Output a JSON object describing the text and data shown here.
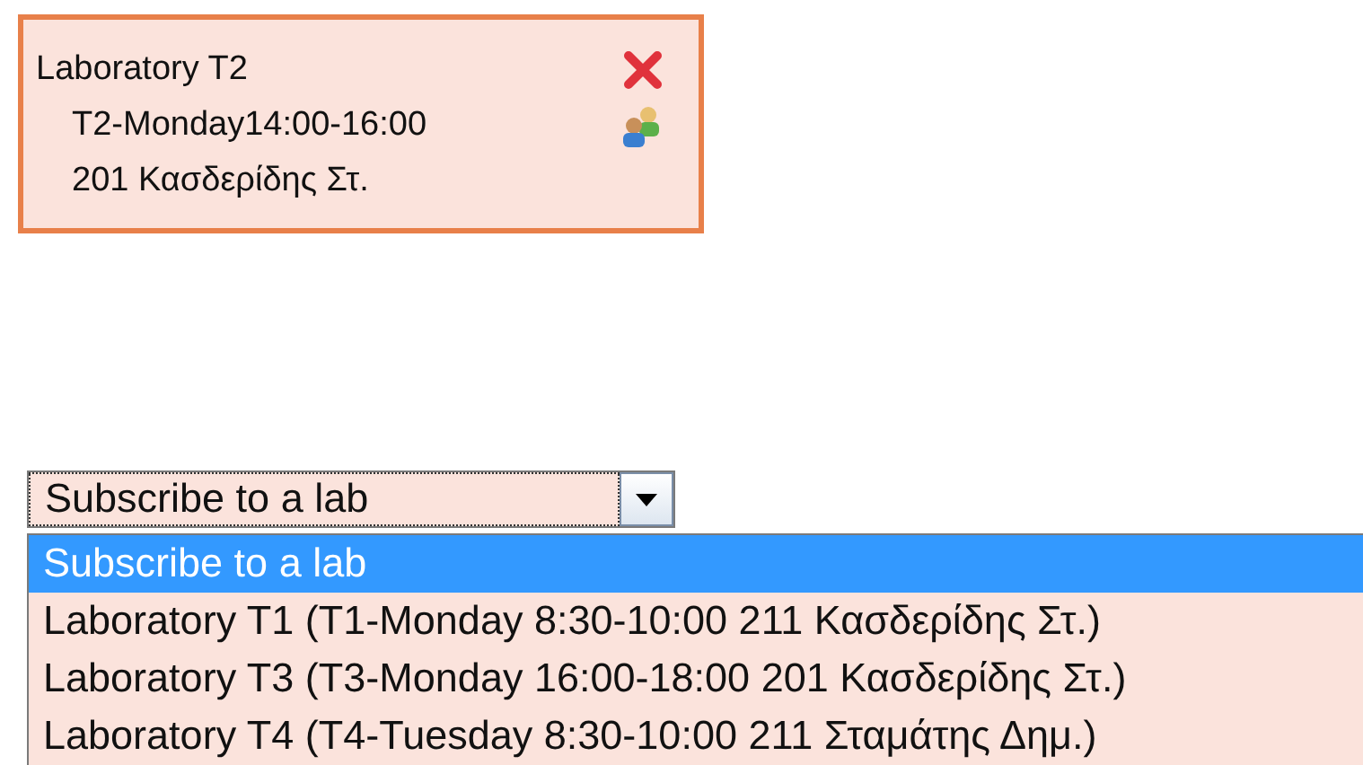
{
  "lab_card": {
    "title": "Laboratory T2",
    "schedule": "T2-Monday14:00-16:00",
    "room": "201 Κασδερίδης Στ."
  },
  "dropdown": {
    "value": "Subscribe to a lab",
    "expanded": true,
    "options": [
      {
        "label": "Subscribe to a lab",
        "selected": true
      },
      {
        "label": "Laboratory T1 (T1-Monday 8:30-10:00 211 Κασδερίδης Στ.)",
        "selected": false
      },
      {
        "label": "Laboratory T3 (T3-Monday 16:00-18:00 201 Κασδερίδης Στ.)",
        "selected": false
      },
      {
        "label": "Laboratory T4 (T4-Tuesday 8:30-10:00 211 Σταμάτης Δημ.)",
        "selected": false
      }
    ]
  }
}
